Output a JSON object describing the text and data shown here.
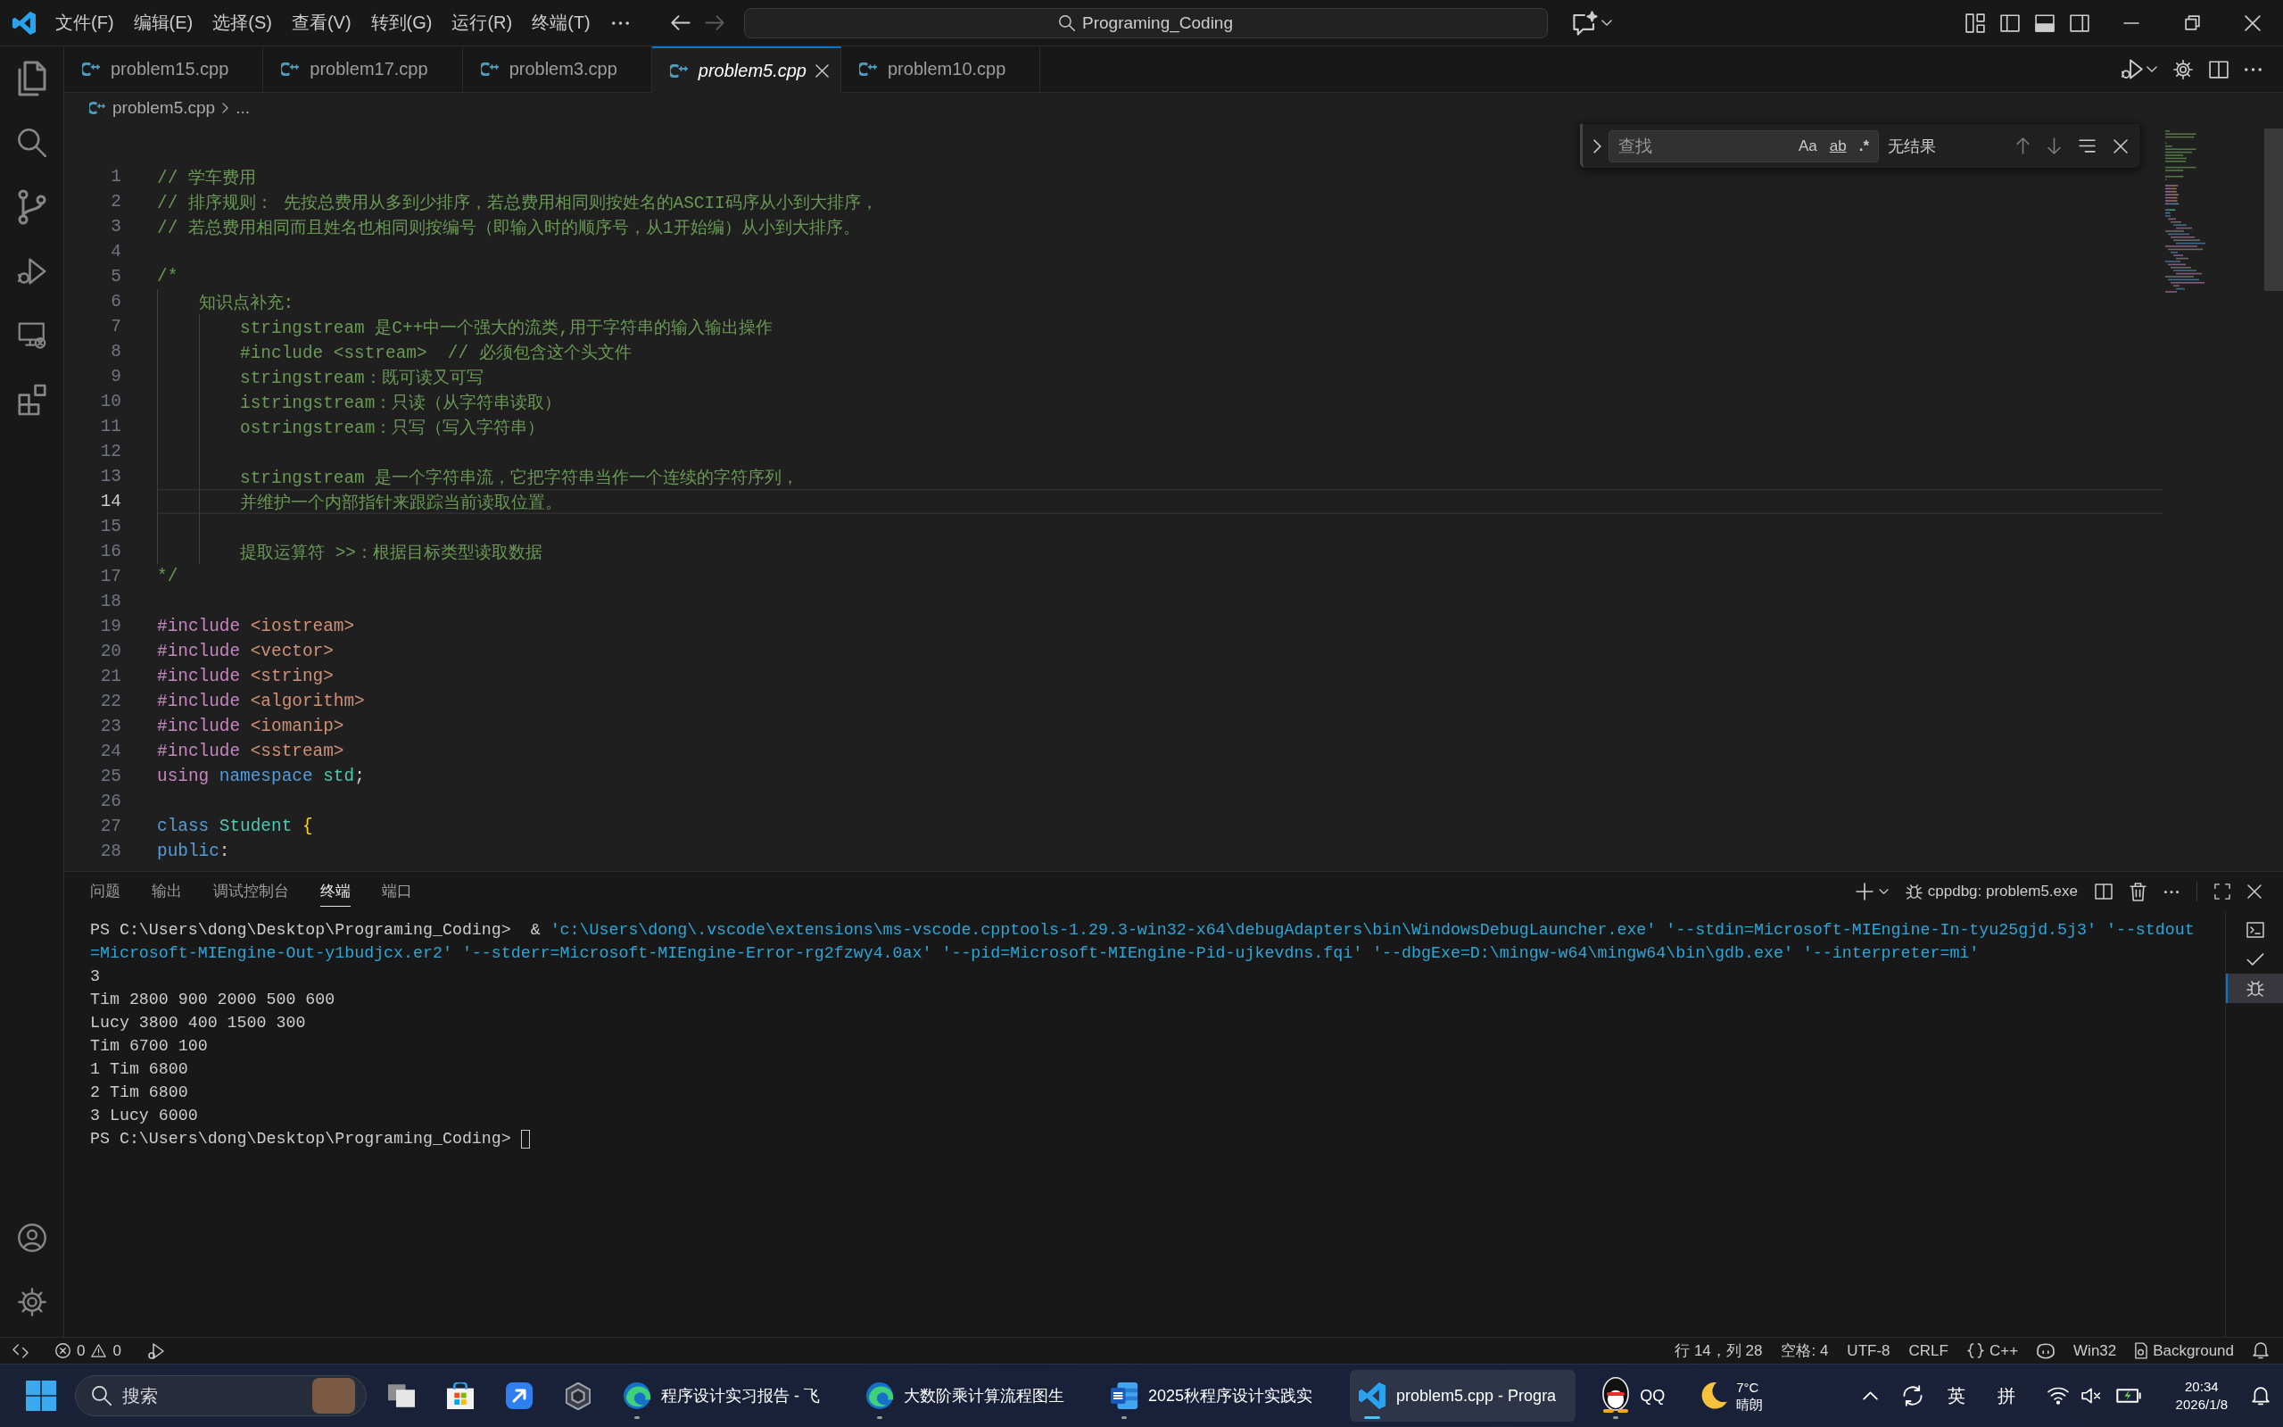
{
  "title_bar": {
    "menus": [
      "文件(F)",
      "编辑(E)",
      "选择(S)",
      "查看(V)",
      "转到(G)",
      "运行(R)",
      "终端(T)"
    ],
    "nav_buttons": [
      {
        "kind": "back",
        "disabled": false
      },
      {
        "kind": "forward",
        "disabled": true
      }
    ],
    "command_center": "Programing_Coding"
  },
  "tabs": [
    {
      "label": "problem15.cpp",
      "selected": false,
      "preview": false
    },
    {
      "label": "problem17.cpp",
      "selected": false,
      "preview": false
    },
    {
      "label": "problem3.cpp",
      "selected": false,
      "preview": false
    },
    {
      "label": "problem5.cpp",
      "selected": true,
      "preview": true
    },
    {
      "label": "problem10.cpp",
      "selected": false,
      "preview": false
    }
  ],
  "breadcrumb": [
    "problem5.cpp",
    "..."
  ],
  "find_widget": {
    "placeholder": "查找",
    "options": [
      {
        "kind": "case",
        "label": "Aa"
      },
      {
        "kind": "word",
        "label": "ab"
      },
      {
        "kind": "regex",
        "label": ".*"
      }
    ],
    "result": "无结果"
  },
  "code": {
    "lines": [
      {
        "number": "1",
        "current": false,
        "tokens": [
          {
            "kind": "comment",
            "text": "// 学车费用"
          }
        ]
      },
      {
        "number": "2",
        "current": false,
        "tokens": [
          {
            "kind": "comment",
            "text": "// 排序规则： 先按总费用从多到少排序，若总费用相同则按姓名的ASCII码序从小到大排序，"
          }
        ]
      },
      {
        "number": "3",
        "current": false,
        "tokens": [
          {
            "kind": "comment",
            "text": "// 若总费用相同而且姓名也相同则按编号（即输入时的顺序号，从1开始编）从小到大排序。"
          }
        ]
      },
      {
        "number": "4",
        "current": false
      },
      {
        "number": "5",
        "current": false,
        "tokens": [
          {
            "kind": "comment",
            "text": "/*"
          }
        ]
      },
      {
        "number": "6",
        "current": false,
        "tokens": [
          {
            "kind": "comment",
            "text": "    知识点补充:"
          }
        ]
      },
      {
        "number": "7",
        "current": false,
        "tokens": [
          {
            "kind": "comment",
            "text": "        stringstream 是C++中一个强大的流类,用于字符串的输入输出操作"
          }
        ]
      },
      {
        "number": "8",
        "current": false,
        "tokens": [
          {
            "kind": "comment",
            "text": "        #include <sstream>  // 必须包含这个头文件"
          }
        ]
      },
      {
        "number": "9",
        "current": false,
        "tokens": [
          {
            "kind": "comment",
            "text": "        stringstream：既可读又可写"
          }
        ]
      },
      {
        "number": "10",
        "current": false,
        "tokens": [
          {
            "kind": "comment",
            "text": "        istringstream：只读（从字符串读取）"
          }
        ]
      },
      {
        "number": "11",
        "current": false,
        "tokens": [
          {
            "kind": "comment",
            "text": "        ostringstream：只写（写入字符串）"
          }
        ]
      },
      {
        "number": "12",
        "current": false
      },
      {
        "number": "13",
        "current": false,
        "tokens": [
          {
            "kind": "comment",
            "text": "        stringstream 是一个字符串流，它把字符串当作一个连续的字符序列，"
          }
        ]
      },
      {
        "number": "14",
        "current": true,
        "tokens": [
          {
            "kind": "comment",
            "text": "        并维护一个内部指针来跟踪当前读取位置。"
          }
        ]
      },
      {
        "number": "15",
        "current": false
      },
      {
        "number": "16",
        "current": false,
        "tokens": [
          {
            "kind": "comment",
            "text": "        提取运算符 >>：根据目标类型读取数据"
          }
        ]
      },
      {
        "number": "17",
        "current": false,
        "tokens": [
          {
            "kind": "comment",
            "text": "*/"
          }
        ]
      },
      {
        "number": "18",
        "current": false
      },
      {
        "number": "19",
        "current": false,
        "tokens": [
          {
            "kind": "directive",
            "text": "#include "
          },
          {
            "kind": "header",
            "text": "<iostream>"
          }
        ]
      },
      {
        "number": "20",
        "current": false,
        "tokens": [
          {
            "kind": "directive",
            "text": "#include "
          },
          {
            "kind": "header",
            "text": "<vector>"
          }
        ]
      },
      {
        "number": "21",
        "current": false,
        "tokens": [
          {
            "kind": "directive",
            "text": "#include "
          },
          {
            "kind": "header",
            "text": "<string>"
          }
        ]
      },
      {
        "number": "22",
        "current": false,
        "tokens": [
          {
            "kind": "directive",
            "text": "#include "
          },
          {
            "kind": "header",
            "text": "<algorithm>"
          }
        ]
      },
      {
        "number": "23",
        "current": false,
        "tokens": [
          {
            "kind": "directive",
            "text": "#include "
          },
          {
            "kind": "header",
            "text": "<iomanip>"
          }
        ]
      },
      {
        "number": "24",
        "current": false,
        "tokens": [
          {
            "kind": "directive",
            "text": "#include "
          },
          {
            "kind": "header",
            "text": "<sstream>"
          }
        ]
      },
      {
        "number": "25",
        "current": false,
        "tokens": [
          {
            "kind": "control",
            "text": "using "
          },
          {
            "kind": "keyword",
            "text": "namespace "
          },
          {
            "kind": "type",
            "text": "std"
          },
          {
            "kind": "plain",
            "text": ";"
          }
        ]
      },
      {
        "number": "26",
        "current": false
      },
      {
        "number": "27",
        "current": false,
        "tokens": [
          {
            "kind": "keyword",
            "text": "class "
          },
          {
            "kind": "type",
            "text": "Student "
          },
          {
            "kind": "bracket",
            "text": "{"
          }
        ]
      },
      {
        "number": "28",
        "current": false,
        "tokens": [
          {
            "kind": "keyword",
            "text": "public"
          },
          {
            "kind": "plain",
            "text": ":"
          }
        ]
      }
    ]
  },
  "panel": {
    "tabs": [
      {
        "label": "问题",
        "selected": false
      },
      {
        "label": "输出",
        "selected": false
      },
      {
        "label": "调试控制台",
        "selected": false
      },
      {
        "label": "终端",
        "selected": true
      },
      {
        "label": "端口",
        "selected": false
      }
    ],
    "terminal_name": "cppdbg: problem5.exe",
    "terminal": {
      "lines": [
        {
          "kind": "command",
          "prompt": "PS C:\\Users\\dong\\Desktop\\Programing_Coding>",
          "operator": "&",
          "argument": "'c:\\Users\\dong\\.vscode\\extensions\\ms-vscode.cpptools-1.29.3-win32-x64\\debugAdapters\\bin\\WindowsDebugLauncher.exe' '--stdin=Microsoft-MIEngine-In-tyu25gjd.5j3' '--stdout"
        },
        {
          "kind": "continuation",
          "text": "=Microsoft-MIEngine-Out-y1budjcx.er2' '--stderr=Microsoft-MIEngine-Error-rg2fzwy4.0ax' '--pid=Microsoft-MIEngine-Pid-ujkevdns.fqi' '--dbgExe=D:\\mingw-w64\\mingw64\\bin\\gdb.exe' '--interpreter=mi'"
        },
        {
          "kind": "output",
          "text": "3"
        },
        {
          "kind": "output",
          "text": "Tim 2800 900 2000 500 600"
        },
        {
          "kind": "output",
          "text": "Lucy 3800 400 1500 300"
        },
        {
          "kind": "output",
          "text": "Tim 6700 100"
        },
        {
          "kind": "output",
          "text": "1 Tim 6800"
        },
        {
          "kind": "output",
          "text": "2 Tim 6800"
        },
        {
          "kind": "output",
          "text": "3 Lucy 6000"
        },
        {
          "kind": "prompt",
          "prompt": "PS C:\\Users\\dong\\Desktop\\Programing_Coding>"
        }
      ]
    },
    "terminal_tabs": [
      {
        "kind": "shell",
        "selected": false
      },
      {
        "kind": "task",
        "selected": false
      },
      {
        "kind": "debug",
        "selected": true
      }
    ]
  },
  "status_bar": {
    "problems": {
      "errors": "0",
      "warnings": "0"
    },
    "cursor_position": "行 14，列 28",
    "indentation": "空格: 4",
    "encoding": "UTF-8",
    "line_ending": "CRLF",
    "language": "C++",
    "platform": "Win32",
    "background_task": "Background"
  },
  "taskbar": {
    "search": {
      "placeholder": "搜索"
    },
    "windows": [
      {
        "kind": "edge",
        "label": "程序设计实习报告 - 飞",
        "selected": false
      },
      {
        "kind": "edge",
        "label": "大数阶乘计算流程图生",
        "selected": false
      },
      {
        "kind": "word",
        "label": "2025秋程序设计实践实",
        "selected": false
      },
      {
        "kind": "vscode",
        "label": "problem5.cpp - Progra",
        "selected": true
      },
      {
        "kind": "qq",
        "label": "QQ",
        "selected": false
      }
    ],
    "weather": {
      "temperature": "7°C",
      "condition": "晴朗"
    },
    "input_indicators": [
      "英",
      "拼"
    ],
    "clock": {
      "time": "20:34",
      "date": "2026/1/8"
    }
  }
}
